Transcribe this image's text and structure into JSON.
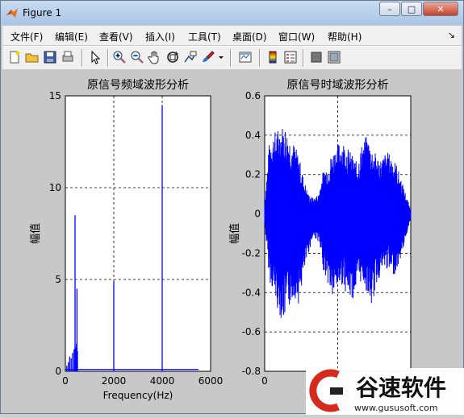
{
  "window": {
    "title": "Figure 1",
    "controls": {
      "minimize": "–",
      "maximize": "□",
      "close": "✕"
    }
  },
  "menu": {
    "items": [
      "文件(F)",
      "编辑(E)",
      "查看(V)",
      "插入(I)",
      "工具(T)",
      "桌面(D)",
      "窗口(W)",
      "帮助(H)"
    ],
    "overflow": "↘"
  },
  "toolbar": {
    "icons": [
      "new-figure-icon",
      "open-file-icon",
      "save-icon",
      "print-icon",
      "select-arrow-icon",
      "zoom-in-icon",
      "zoom-out-icon",
      "pan-hand-icon",
      "rotate-3d-icon",
      "data-cursor-icon",
      "brush-icon",
      "brush-dropdown-icon",
      "link-plot-icon",
      "colorbar-icon",
      "legend-icon",
      "hide-plot-tools-icon",
      "show-plot-tools-icon"
    ]
  },
  "colors": {
    "series": "#0000ff",
    "figure_bg": "#c8c8c8",
    "axes_bg": "#ffffff",
    "titlebar": "#b8d0ec"
  },
  "chart_data": [
    {
      "type": "bar",
      "title": "原信号频域波形分析",
      "xlabel": "Frequency(Hz)",
      "ylabel": "幅值",
      "xlim": [
        0,
        6000
      ],
      "ylim": [
        0,
        15
      ],
      "xticks": [
        "0",
        "2000",
        "4000",
        "6000"
      ],
      "yticks": [
        "0",
        "5",
        "10",
        "15"
      ],
      "grid": true,
      "x": [
        60,
        120,
        180,
        240,
        300,
        360,
        400,
        430,
        460,
        480,
        500,
        2000,
        4000
      ],
      "values": [
        0.3,
        0.5,
        0.8,
        0.7,
        1.0,
        1.2,
        8.5,
        1.3,
        1.5,
        4.5,
        1.1,
        4.9,
        14.5
      ]
    },
    {
      "type": "line",
      "title": "原信号时域波形分析",
      "xlabel": "",
      "ylabel": "幅值",
      "xlim": [
        0,
        3
      ],
      "ylim": [
        -0.8,
        0.6
      ],
      "xticks": [
        "0",
        "",
        ""
      ],
      "yticks": [
        "0.6",
        "0.4",
        "0.2",
        "0",
        "-0.2",
        "-0.4",
        "-0.6",
        "-0.8"
      ],
      "grid": true,
      "envelope_x": [
        0,
        0.1,
        0.2,
        0.3,
        0.4,
        0.5,
        0.6,
        0.7,
        0.8,
        0.9,
        1.0,
        1.1,
        1.2,
        1.3,
        1.4,
        1.5,
        1.6,
        1.7,
        1.8,
        1.9,
        2.0,
        2.1,
        2.2,
        2.3,
        2.4,
        2.5,
        2.6,
        2.7,
        2.8,
        2.9,
        3.0
      ],
      "envelope_upper": [
        0.05,
        0.38,
        0.42,
        0.44,
        0.46,
        0.4,
        0.36,
        0.3,
        0.18,
        0.1,
        0.08,
        0.1,
        0.22,
        0.26,
        0.32,
        0.36,
        0.38,
        0.34,
        0.3,
        0.26,
        0.36,
        0.4,
        0.34,
        0.3,
        0.28,
        0.32,
        0.3,
        0.26,
        0.18,
        0.1,
        0.02
      ],
      "envelope_lower": [
        -0.05,
        -0.34,
        -0.42,
        -0.52,
        -0.55,
        -0.48,
        -0.42,
        -0.46,
        -0.32,
        -0.2,
        -0.12,
        -0.14,
        -0.28,
        -0.36,
        -0.44,
        -0.38,
        -0.36,
        -0.42,
        -0.44,
        -0.38,
        -0.34,
        -0.4,
        -0.48,
        -0.36,
        -0.3,
        -0.28,
        -0.32,
        -0.3,
        -0.22,
        -0.12,
        -0.02
      ]
    }
  ]
}
